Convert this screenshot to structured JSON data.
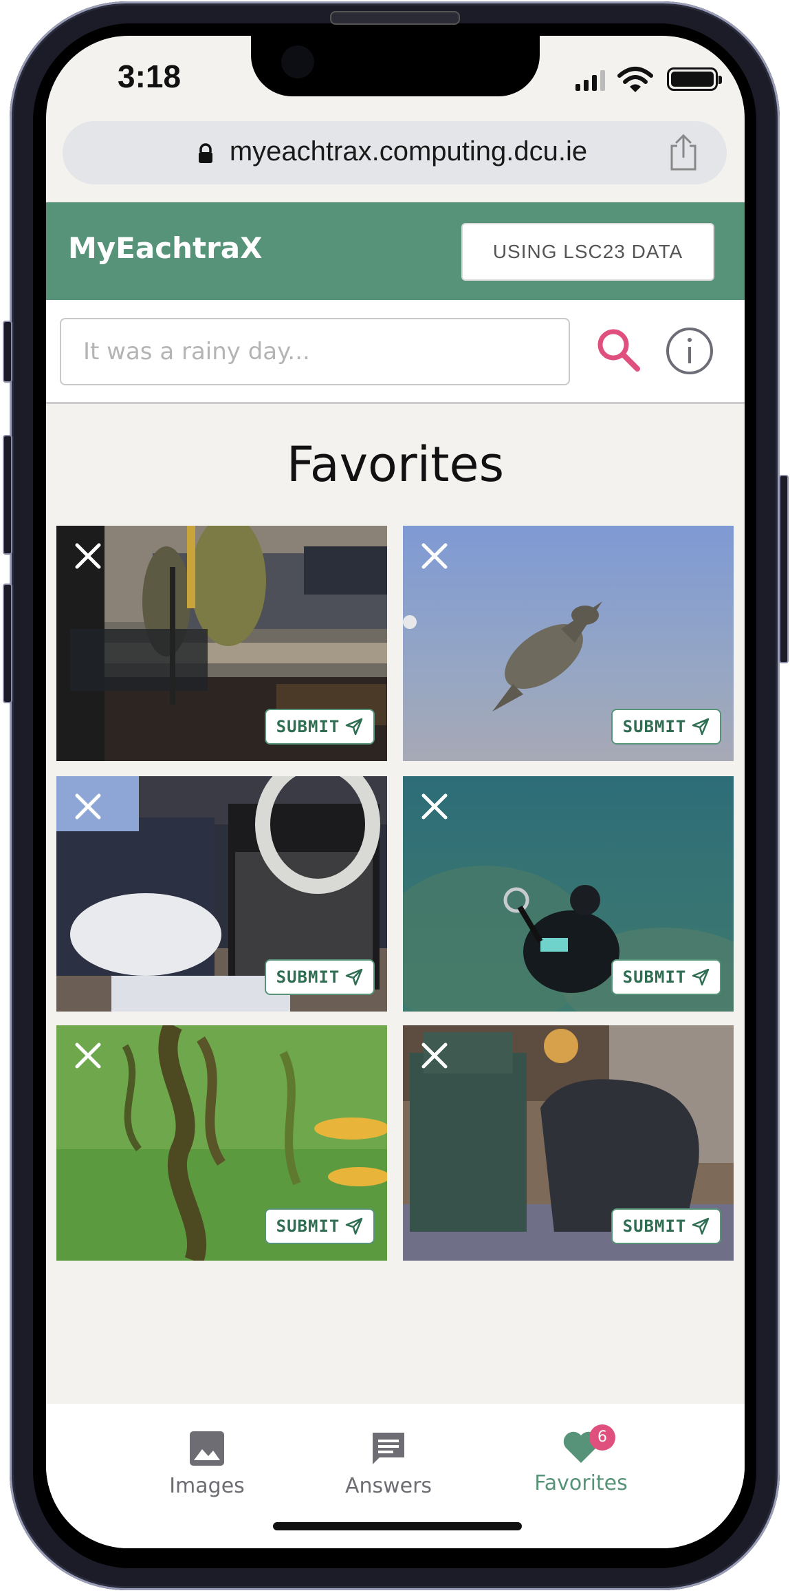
{
  "status_bar": {
    "time": "3:18"
  },
  "browser": {
    "url": "myeachtrax.computing.dcu.ie"
  },
  "app_bar": {
    "brand": "MyEachtraX",
    "dataset_button": "USING LSC23 DATA"
  },
  "search": {
    "placeholder": "It was a rainy day..."
  },
  "page": {
    "title": "Favorites"
  },
  "favorites": [
    {
      "scene": "street-interior",
      "submit_label": "SUBMIT"
    },
    {
      "scene": "sea-turtle",
      "submit_label": "SUBMIT"
    },
    {
      "scene": "vox-amplifier",
      "submit_label": "SUBMIT"
    },
    {
      "scene": "scuba-diver",
      "submit_label": "SUBMIT"
    },
    {
      "scene": "kelp-underwater",
      "submit_label": "SUBMIT"
    },
    {
      "scene": "amp-and-chair",
      "submit_label": "SUBMIT"
    }
  ],
  "tabs": [
    {
      "label": "Images",
      "icon": "image-icon",
      "active": false
    },
    {
      "label": "Answers",
      "icon": "message-icon",
      "active": false
    },
    {
      "label": "Favorites",
      "icon": "heart-icon",
      "active": true,
      "badge": "6"
    }
  ],
  "colors": {
    "brand_green": "#569378",
    "accent_pink": "#e0507e",
    "background": "#f3f2ee"
  }
}
